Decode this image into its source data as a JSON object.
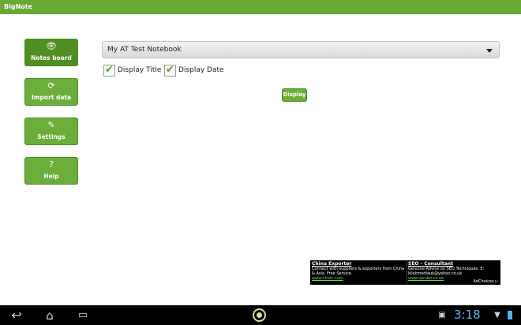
{
  "app": {
    "title": "BigNote"
  },
  "nav": [
    {
      "id": "notes-board",
      "label": "Notes board",
      "icon": "eye-icon",
      "glyph": "👁",
      "active": true
    },
    {
      "id": "import-data",
      "label": "Import data",
      "icon": "refresh-icon",
      "glyph": "⟳",
      "active": false
    },
    {
      "id": "settings",
      "label": "Settings",
      "icon": "wrench-icon",
      "glyph": "✎",
      "active": false
    },
    {
      "id": "help",
      "label": "Help",
      "icon": "question-icon",
      "glyph": "?",
      "active": false
    }
  ],
  "notebook_select": {
    "selected": "My AT Test Notebook"
  },
  "options": {
    "display_title": {
      "label": "Display Title",
      "checked": true
    },
    "display_date": {
      "label": "Display Date",
      "checked": true
    }
  },
  "display_button": {
    "label": "Display"
  },
  "ad": {
    "left": {
      "title": "China Exporter",
      "text": "Connect with suppliers & exporters from China & Asia. Free Service.",
      "link": "www.hktdc.com"
    },
    "right": {
      "title": "SEO - Consultant",
      "text": "Genuine Advice on SEO Techniques. E: klickmediauk@yahoo.co.uk",
      "link": "www.spnder.co.uk"
    },
    "adchoices": "AdChoices ▷"
  },
  "system_bar": {
    "back_glyph": "↩",
    "home_glyph": "⌂",
    "recents_glyph": "▭",
    "time": "3:18"
  },
  "colors": {
    "brand_green": "#69a936",
    "clock_blue": "#4fb7e8"
  }
}
